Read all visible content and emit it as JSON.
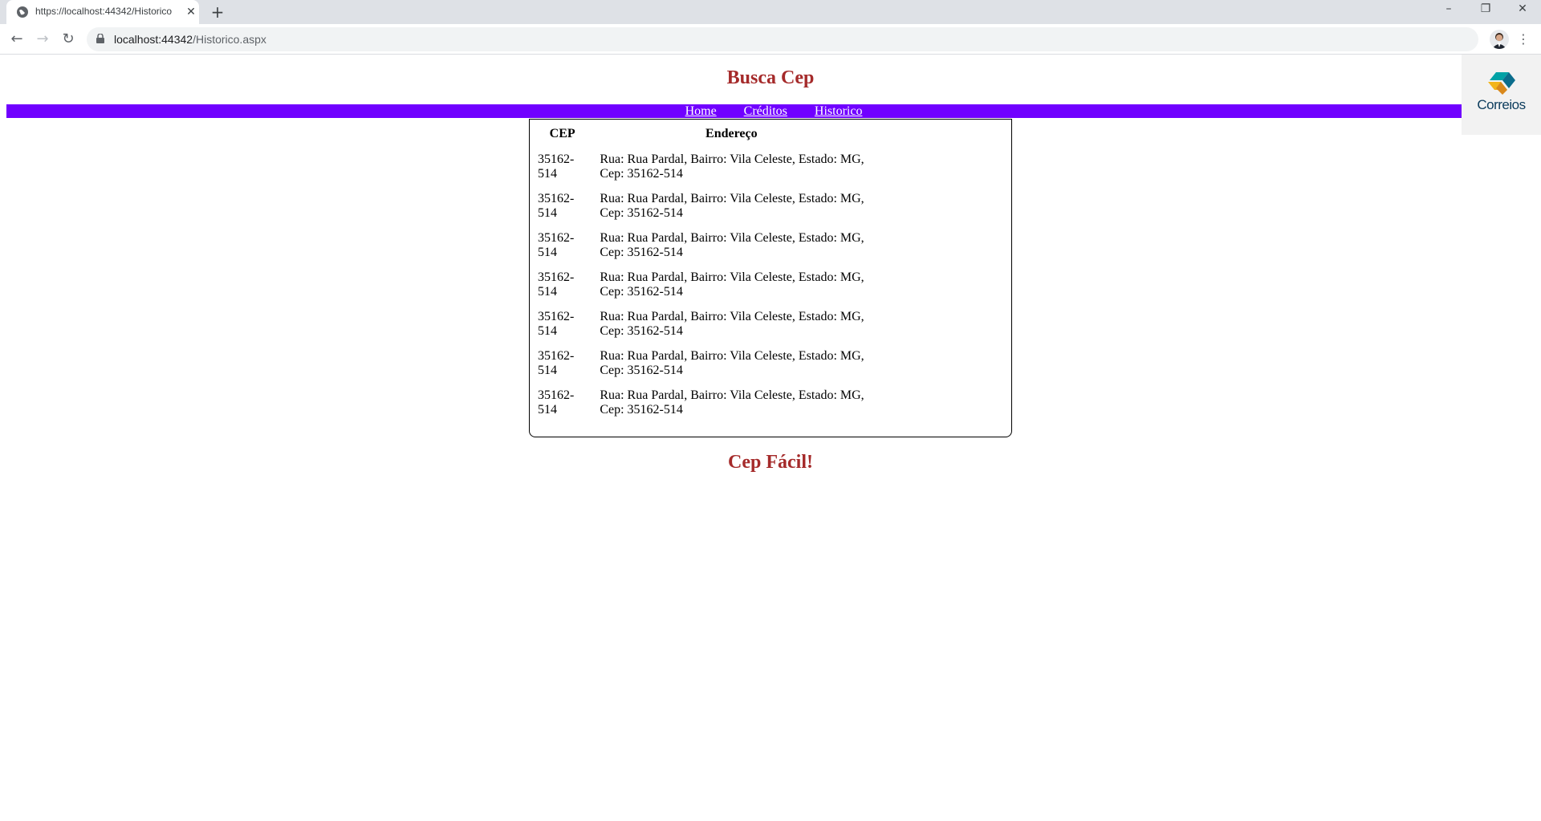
{
  "browser": {
    "tab_title": "https://localhost:44342/Historico",
    "url_host": "localhost:44342",
    "url_path": "/Historico.aspx"
  },
  "page": {
    "title": "Busca Cep",
    "footer": "Cep Fácil!"
  },
  "nav": {
    "links": [
      "Home",
      "Créditos",
      "Historico"
    ]
  },
  "logo": {
    "text": "Correios"
  },
  "history": {
    "headers": [
      "CEP",
      "Endereço"
    ],
    "rows": [
      {
        "cep_line1": "35162-",
        "cep_line2": "514",
        "addr_line1": "Rua: Rua Pardal, Bairro: Vila Celeste, Estado: MG,",
        "addr_line2": "Cep: 35162-514"
      },
      {
        "cep_line1": "35162-",
        "cep_line2": "514",
        "addr_line1": "Rua: Rua Pardal, Bairro: Vila Celeste, Estado: MG,",
        "addr_line2": "Cep: 35162-514"
      },
      {
        "cep_line1": "35162-",
        "cep_line2": "514",
        "addr_line1": "Rua: Rua Pardal, Bairro: Vila Celeste, Estado: MG,",
        "addr_line2": "Cep: 35162-514"
      },
      {
        "cep_line1": "35162-",
        "cep_line2": "514",
        "addr_line1": "Rua: Rua Pardal, Bairro: Vila Celeste, Estado: MG,",
        "addr_line2": "Cep: 35162-514"
      },
      {
        "cep_line1": "35162-",
        "cep_line2": "514",
        "addr_line1": "Rua: Rua Pardal, Bairro: Vila Celeste, Estado: MG,",
        "addr_line2": "Cep: 35162-514"
      },
      {
        "cep_line1": "35162-",
        "cep_line2": "514",
        "addr_line1": "Rua: Rua Pardal, Bairro: Vila Celeste, Estado: MG,",
        "addr_line2": "Cep: 35162-514"
      },
      {
        "cep_line1": "35162-",
        "cep_line2": "514",
        "addr_line1": "Rua: Rua Pardal, Bairro: Vila Celeste, Estado: MG,",
        "addr_line2": "Cep: 35162-514"
      }
    ]
  },
  "colors": {
    "title_color": "#a52a2a",
    "nav_bar": "#7000ff"
  },
  "icons": [
    "globe-icon",
    "close-icon",
    "plus-icon",
    "minimize-icon",
    "restore-icon",
    "window-close-icon",
    "back-icon",
    "forward-icon",
    "reload-icon",
    "lock-icon",
    "star-icon",
    "profile-avatar",
    "menu-icon",
    "correios-logo"
  ]
}
